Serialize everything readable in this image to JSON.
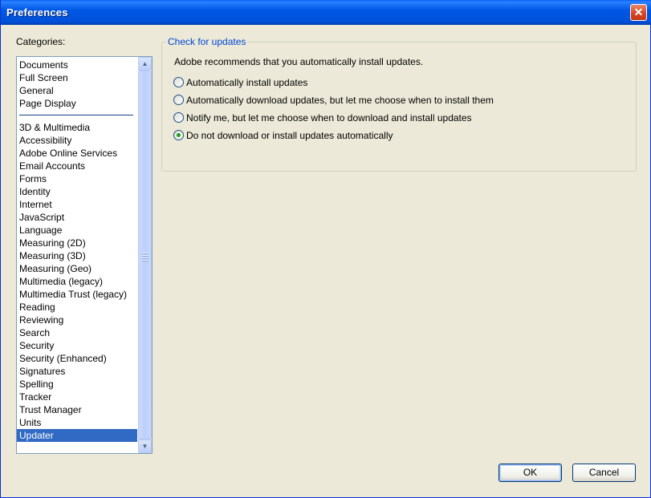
{
  "window": {
    "title": "Preferences",
    "close_glyph": "✕"
  },
  "categories": {
    "label": "Categories:",
    "group1": [
      "Documents",
      "Full Screen",
      "General",
      "Page Display"
    ],
    "group2": [
      "3D & Multimedia",
      "Accessibility",
      "Adobe Online Services",
      "Email Accounts",
      "Forms",
      "Identity",
      "Internet",
      "JavaScript",
      "Language",
      "Measuring (2D)",
      "Measuring (3D)",
      "Measuring (Geo)",
      "Multimedia (legacy)",
      "Multimedia Trust (legacy)",
      "Reading",
      "Reviewing",
      "Search",
      "Security",
      "Security (Enhanced)",
      "Signatures",
      "Spelling",
      "Tracker",
      "Trust Manager",
      "Units",
      "Updater"
    ],
    "selected": "Updater"
  },
  "updates": {
    "group_title": "Check for updates",
    "description": "Adobe recommends that you automatically install updates.",
    "options": [
      {
        "label": "Automatically install updates",
        "checked": false
      },
      {
        "label": "Automatically download updates, but let me choose when to install them",
        "checked": false
      },
      {
        "label": "Notify me, but let me choose when to download and install updates",
        "checked": false
      },
      {
        "label": "Do not download or install updates automatically",
        "checked": true
      }
    ]
  },
  "buttons": {
    "ok": "OK",
    "cancel": "Cancel"
  },
  "colors": {
    "title_bar": "#0058e6",
    "selection": "#316ac5",
    "group_title": "#0046d5",
    "dialog_bg": "#ece9d8",
    "radio_dot": "#21a121"
  },
  "icons": {
    "close": "close-icon",
    "scroll_up": "chevron-up-icon",
    "scroll_down": "chevron-down-icon"
  }
}
